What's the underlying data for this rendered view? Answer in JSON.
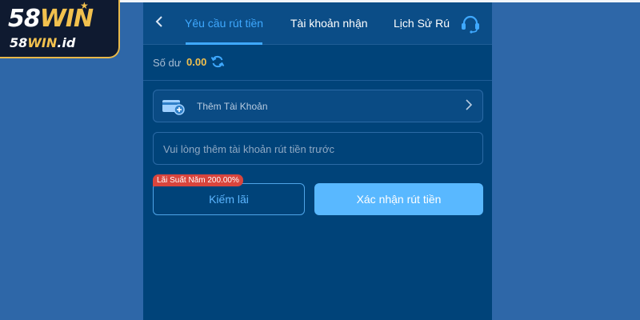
{
  "logo": {
    "brand_prefix": "58",
    "brand_suffix": "WIN",
    "sub_prefix": "58",
    "sub_suffix": "WIN",
    "sub_domain": ".id"
  },
  "header": {
    "tabs": [
      {
        "label": "Yêu cầu rút tiền",
        "active": true
      },
      {
        "label": "Tài khoản nhận",
        "active": false
      },
      {
        "label": "Lịch Sử Rú",
        "active": false
      }
    ]
  },
  "balance": {
    "label": "Số dư",
    "value": "0.00"
  },
  "add_account": {
    "label": "Thêm Tài Khoản"
  },
  "notice": {
    "text": "Vui lòng thêm tài khoản rút tiền trước"
  },
  "actions": {
    "rate_badge": "Lãi Suất Năm 200.00%",
    "earn_label": "Kiếm lãi",
    "confirm_label": "Xác nhận rút tiền"
  },
  "icons": {
    "back": "chevron-left-icon",
    "support": "headset-icon",
    "refresh": "refresh-icon",
    "wallet": "wallet-add-icon",
    "chevron": "chevron-right-icon"
  },
  "colors": {
    "background": "#2e67a8",
    "panel": "#004379",
    "accent": "#3fa9ff",
    "balance": "#f2c14e",
    "badge": "#d9453d",
    "confirm": "#59b8ff"
  }
}
